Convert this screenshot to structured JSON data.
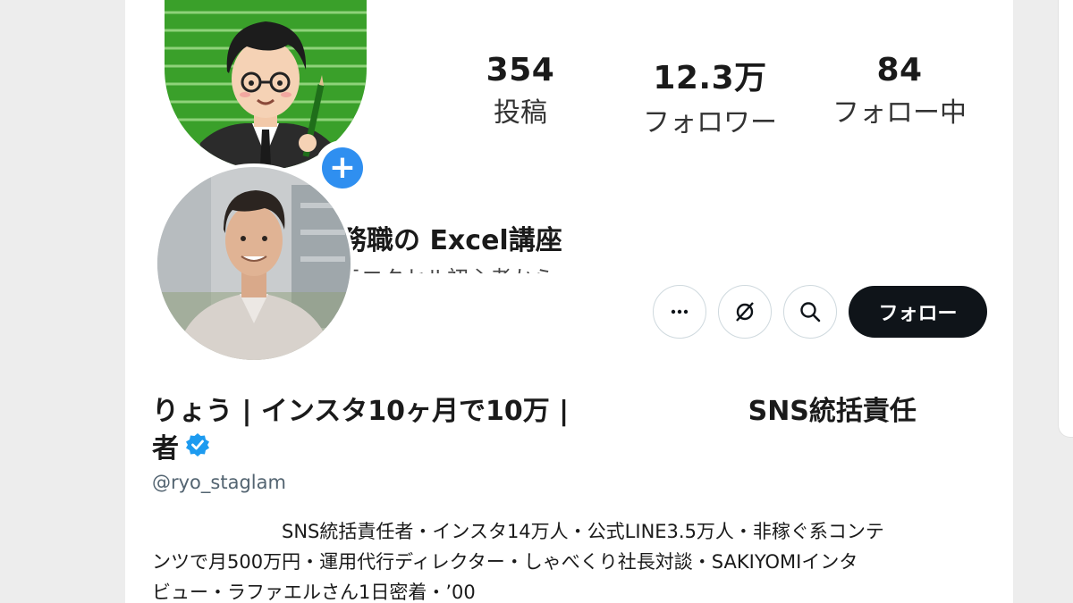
{
  "instagram": {
    "stats": [
      {
        "value": "354",
        "label": "投稿"
      },
      {
        "value": "12.3万",
        "label": "フォロワー"
      },
      {
        "value": "84",
        "label": "フォロー中"
      }
    ],
    "name_partial": "務職の Excel講座",
    "bio_partial": "元エクセル初心者から…",
    "plus_icon": "plus-icon"
  },
  "x_profile": {
    "display_name_start": "りょう | インスタ10ヶ月で10万 | ",
    "display_name_end": "SNS統括責任",
    "display_name_line2": "者",
    "handle": "@ryo_staglam",
    "bio_lines": [
      "SNS統括責任者・インスタ14万人・公式LINE3.5万人・非稼ぐ系コンテ",
      "ンツで月500万円・運用代行ディレクター・しゃべくり社長対談・SAKIYOMIインタ",
      "ビュー・ラファエルさん1日密着・’00"
    ],
    "follow_label": "フォロー",
    "buttons": [
      "more-icon",
      "grok-icon",
      "search-icon"
    ]
  },
  "colors": {
    "accent_blue": "#2f8ff0",
    "verified_blue": "#1d9bf0",
    "follow_bg": "#0f1419",
    "handle_gray": "#536471"
  }
}
